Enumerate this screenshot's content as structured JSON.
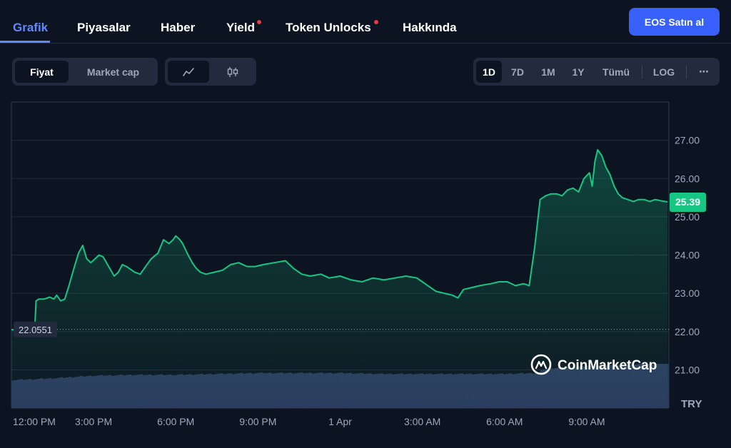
{
  "nav": {
    "tabs": [
      {
        "label": "Grafik",
        "active": true
      },
      {
        "label": "Piyasalar"
      },
      {
        "label": "Haber"
      },
      {
        "label": "Yield",
        "dot": true
      },
      {
        "label": "Token Unlocks",
        "dot": true
      },
      {
        "label": "Hakkında"
      }
    ],
    "buy_button": "EOS Satın al"
  },
  "toolbar": {
    "fiyat": "Fiyat",
    "market_cap": "Market cap",
    "line_icon": "line-chart-icon",
    "candle_icon": "candlestick-icon",
    "ranges": [
      "1D",
      "7D",
      "1M",
      "1Y",
      "Tümü"
    ],
    "selected_range": "1D",
    "log": "LOG",
    "more": "⋯"
  },
  "colors": {
    "background": "#0d1421",
    "line": "#16c784",
    "accent": "#3861fb",
    "active_tab": "#6188ff",
    "volume": "#2c3b5e"
  },
  "chart_data": {
    "type": "area",
    "x_tick_labels": [
      "12:00 PM",
      "3:00 PM",
      "6:00 PM",
      "9:00 PM",
      "1 Apr",
      "3:00 AM",
      "6:00 AM",
      "9:00 AM"
    ],
    "x_tick_hours": [
      0,
      3,
      6,
      9,
      12,
      15,
      18,
      21
    ],
    "y_ticks": [
      21.0,
      22.0,
      23.0,
      24.0,
      25.0,
      26.0,
      27.0
    ],
    "y_tick_labels": [
      "21.00",
      "22.00",
      "23.00",
      "24.00",
      "25.00",
      "26.00",
      "27.00"
    ],
    "ylim": [
      20.0,
      28.0
    ],
    "xlim_hours": [
      0,
      24
    ],
    "currency": "TRY",
    "open_price": 22.0551,
    "open_label": "22.0551",
    "current_price": 25.39,
    "current_label": "25.39",
    "watermark": "CoinMarketCap",
    "series": [
      {
        "x_hours": [
          0,
          0.85,
          0.9,
          1.0,
          1.2,
          1.4,
          1.55,
          1.65,
          1.8,
          1.95,
          2.1,
          2.3,
          2.45,
          2.6,
          2.75,
          2.9,
          3.05,
          3.2,
          3.35,
          3.55,
          3.75,
          3.9,
          4.05,
          4.2,
          4.5,
          4.7,
          4.9,
          5.1,
          5.35,
          5.55,
          5.75,
          5.9,
          6.0,
          6.15,
          6.25,
          6.35,
          6.45,
          6.6,
          6.75,
          6.9,
          7.1,
          7.4,
          7.7,
          8.0,
          8.3,
          8.6,
          8.9,
          9.2,
          9.6,
          10.0,
          10.3,
          10.6,
          10.9,
          11.3,
          11.6,
          12.0,
          12.4,
          12.8,
          13.2,
          13.6,
          14.0,
          14.4,
          14.8,
          15.0,
          15.2,
          15.5,
          15.8,
          16.1,
          16.3,
          16.5,
          16.8,
          17.1,
          17.5,
          17.8,
          18.1,
          18.4,
          18.7,
          18.9,
          19.1,
          19.3,
          19.5,
          19.7,
          19.9,
          20.1,
          20.3,
          20.5,
          20.7,
          20.9,
          21.1,
          21.2,
          21.3,
          21.4,
          21.55,
          21.7,
          21.85,
          22.0,
          22.15,
          22.3,
          22.5,
          22.7,
          22.9,
          23.1,
          23.3,
          23.5,
          23.7,
          23.95
        ],
        "y": [
          22.05,
          22.05,
          22.8,
          22.85,
          22.85,
          22.9,
          22.85,
          22.95,
          22.8,
          22.85,
          23.2,
          23.7,
          24.05,
          24.25,
          23.9,
          23.8,
          23.9,
          24.0,
          23.95,
          23.7,
          23.45,
          23.55,
          23.75,
          23.7,
          23.55,
          23.5,
          23.7,
          23.9,
          24.05,
          24.4,
          24.3,
          24.4,
          24.5,
          24.4,
          24.3,
          24.15,
          24.0,
          23.8,
          23.65,
          23.55,
          23.5,
          23.55,
          23.6,
          23.75,
          23.8,
          23.7,
          23.7,
          23.75,
          23.8,
          23.85,
          23.65,
          23.5,
          23.45,
          23.5,
          23.4,
          23.45,
          23.35,
          23.3,
          23.4,
          23.35,
          23.4,
          23.45,
          23.4,
          23.3,
          23.2,
          23.05,
          23.0,
          22.95,
          22.88,
          23.1,
          23.15,
          23.2,
          23.25,
          23.3,
          23.3,
          23.2,
          23.25,
          23.2,
          24.2,
          25.45,
          25.55,
          25.6,
          25.6,
          25.55,
          25.7,
          25.75,
          25.65,
          26.0,
          26.15,
          25.8,
          26.45,
          26.75,
          26.6,
          26.3,
          26.1,
          25.8,
          25.6,
          25.5,
          25.45,
          25.4,
          25.45,
          25.45,
          25.4,
          25.45,
          25.42,
          25.39
        ]
      }
    ],
    "volume": {
      "x_hours": [
        0,
        1.5,
        3,
        4.5,
        6,
        7.5,
        9,
        10.5,
        12,
        13.5,
        15,
        16.5,
        18,
        19.2,
        19.5,
        20.5,
        21.5,
        22.5,
        23.5,
        24
      ],
      "values": [
        0.62,
        0.66,
        0.72,
        0.74,
        0.74,
        0.76,
        0.78,
        0.78,
        0.78,
        0.76,
        0.76,
        0.76,
        0.76,
        0.78,
        0.88,
        0.92,
        0.95,
        0.97,
        0.99,
        1.0
      ]
    }
  }
}
